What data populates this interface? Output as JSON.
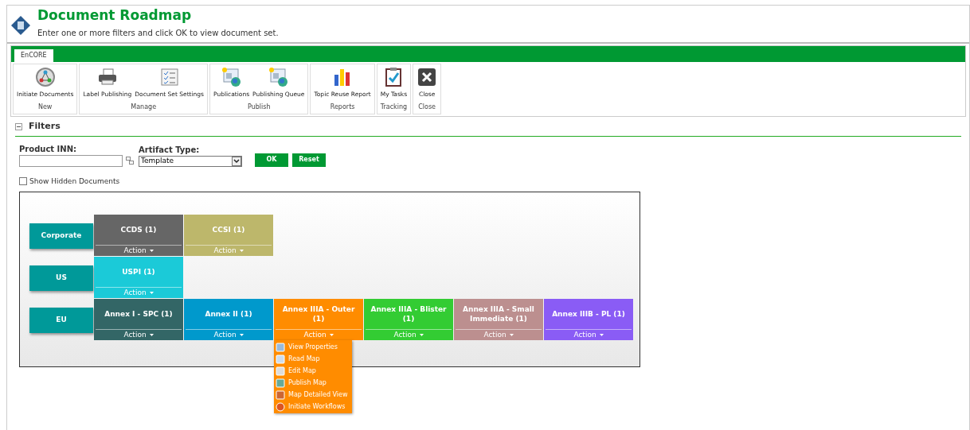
{
  "header": {
    "title": "Document Roadmap",
    "subtitle": "Enter one or more filters and click OK to view document set."
  },
  "ribbon": {
    "tabs": [
      {
        "label": "EnCORE",
        "selected": true
      }
    ],
    "groups": [
      {
        "name": "New",
        "buttons": [
          "Initiate Documents"
        ]
      },
      {
        "name": "Manage",
        "buttons": [
          "Label Publishing",
          "Document Set Settings"
        ]
      },
      {
        "name": "Publish",
        "buttons": [
          "Publications",
          "Publishing Queue"
        ]
      },
      {
        "name": "Reports",
        "buttons": [
          "Topic Reuse Report"
        ]
      },
      {
        "name": "Tracking",
        "buttons": [
          "My Tasks"
        ]
      },
      {
        "name": "Close",
        "buttons": [
          "Close"
        ]
      }
    ]
  },
  "filters": {
    "title": "Filters",
    "expanded": true,
    "product_inn": {
      "label": "Product INN:"
    },
    "artifact_type": {
      "label": "Artifact Type:",
      "value": "Template"
    },
    "buttons": [
      "OK",
      "Reset"
    ],
    "show_hidden": {
      "label": "Show Hidden Documents",
      "checked": false
    }
  },
  "roadmap": {
    "rows": [
      {
        "region": "Corporate",
        "cells": [
          {
            "title": "CCDS (1)",
            "action": "Action",
            "color": "#666666",
            "expanded": false
          },
          {
            "title": "CCSI (1)",
            "action": "Action",
            "color": "#bdb76b",
            "expanded": false
          }
        ]
      },
      {
        "region": "US",
        "cells": [
          {
            "title": "USPI (1)",
            "action": "Action",
            "color": "#1bcad8",
            "expanded": false
          }
        ]
      },
      {
        "region": "EU",
        "cells": [
          {
            "title": "Annex I - SPC (1)",
            "action": "Action",
            "color": "#336666",
            "expanded": false
          },
          {
            "title": "Annex II (1)",
            "action": "Action",
            "color": "#0099cc",
            "expanded": false
          },
          {
            "title": "Annex IIIA - Outer (1)",
            "action": "Action",
            "color": "#ff8c00",
            "expanded": true
          },
          {
            "title": "Annex IIIA - Blister (1)",
            "action": "Action",
            "color": "#33cc33",
            "expanded": false
          },
          {
            "title": "Annex IIIA - Small Immediate (1)",
            "action": "Action",
            "color": "#bc8f8f",
            "expanded": false
          },
          {
            "title": "Annex IIIB - PL (1)",
            "action": "Action",
            "color": "#8a5cf5",
            "expanded": false
          }
        ]
      }
    ],
    "action_menu": [
      "View Properties",
      "Read Map",
      "Edit Map",
      "Publish Map",
      "Map Detailed View",
      "Initiate Workflows"
    ]
  }
}
